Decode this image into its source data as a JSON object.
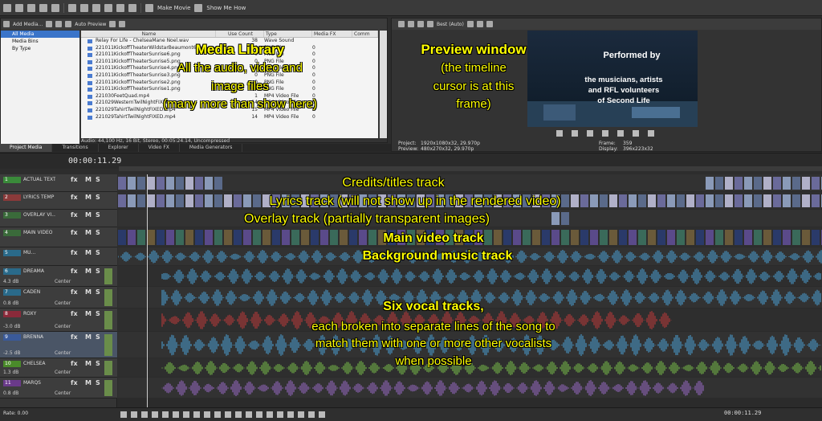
{
  "menubar": {
    "make_movie": "Make Movie",
    "show_me_how": "Show Me How"
  },
  "media": {
    "toolbar": {
      "add_media": "Add Media...",
      "auto_preview": "Auto Preview"
    },
    "tree": [
      "All Media",
      "Media Bins",
      "By Type"
    ],
    "columns": [
      "Name",
      "Use Count",
      "Type",
      "Media FX",
      "Comm"
    ],
    "rows": [
      {
        "name": "Relay For Life - ChelseaMane Noel.wav",
        "count": "38",
        "type": "Wave Sound",
        "fx": ""
      },
      {
        "name": "221011KickoffTheaterWildstarBeaumont6.png",
        "count": "0",
        "type": "PNG File",
        "fx": "0"
      },
      {
        "name": "221011KickoffTheaterSunrise6.png",
        "count": "0",
        "type": "PNG File",
        "fx": "0"
      },
      {
        "name": "221011KickoffTheaterSunrise5.png",
        "count": "0",
        "type": "PNG File",
        "fx": "0"
      },
      {
        "name": "221011KickoffTheaterSunrise4.png",
        "count": "0",
        "type": "PNG File",
        "fx": "0"
      },
      {
        "name": "221011KickoffTheaterSunrise3.png",
        "count": "0",
        "type": "PNG File",
        "fx": "0"
      },
      {
        "name": "221011KickoffTheaterSunrise2.png",
        "count": "0",
        "type": "PNG File",
        "fx": "0"
      },
      {
        "name": "221011KickoffTheaterSunrise1.png",
        "count": "0",
        "type": "PNG File",
        "fx": "0"
      },
      {
        "name": "221030FeetQuad.mp4",
        "count": "1",
        "type": "MP4 Video File",
        "fx": "0"
      },
      {
        "name": "221029WesternTwilNightFIXED.mp4",
        "count": "14",
        "type": "MP4 Video File",
        "fx": "0"
      },
      {
        "name": "221029TahirtTwilNightFIXED.mp4",
        "count": "15",
        "type": "MP4 Video File",
        "fx": "0"
      },
      {
        "name": "221029TahirtTwilNightFIXED.mp4",
        "count": "14",
        "type": "MP4 Video File",
        "fx": "0"
      }
    ],
    "status": "Audio: 44,100 Hz, 16 Bit, Stereo, 00:05:24.14, Uncompressed"
  },
  "tabs": [
    "Project Media",
    "Transitions",
    "Explorer",
    "Video FX",
    "Media Generators"
  ],
  "preview": {
    "quality": "Best (Auto)",
    "overlay_title": "Performed by",
    "overlay_line1": "the musicians, artists",
    "overlay_line2": "and RFL volunteers",
    "overlay_line3": "of Second Life",
    "project_label": "Project:",
    "project_value": "1920x1080x32, 29.970p",
    "preview_label": "Preview:",
    "preview_value": "480x270x32, 29.970p",
    "frame_label": "Frame:",
    "frame_value": "359",
    "display_label": "Display:",
    "display_value": "396x223x32"
  },
  "timeline": {
    "timecode": "00:00:11.29",
    "bottom_timecode": "00:00:11.29",
    "rate": "Rate: 0.00",
    "tracks": [
      {
        "num": "1",
        "name": "ACTUAL TEXT",
        "kind": "video",
        "color": "#3a8a3a"
      },
      {
        "num": "2",
        "name": "LYRICS TEMP",
        "kind": "video",
        "color": "#8a3a3a"
      },
      {
        "num": "3",
        "name": "OVERLAY VI...",
        "kind": "video",
        "color": "#3a6a3a"
      },
      {
        "num": "4",
        "name": "MAIN VIDEO",
        "kind": "video",
        "color": "#3a6a3a"
      },
      {
        "num": "5",
        "name": "MU...",
        "kind": "audio",
        "color": "#2a6a8a"
      },
      {
        "num": "6",
        "name": "DREAMA",
        "kind": "audio",
        "color": "#2a6a8a",
        "vol": "4.3 dB",
        "pan": "Center"
      },
      {
        "num": "7",
        "name": "CADEN",
        "kind": "audio",
        "color": "#2a6a8a",
        "vol": "0.8 dB",
        "pan": "Center"
      },
      {
        "num": "8",
        "name": "ROXY",
        "kind": "audio",
        "color": "#8a2a3a",
        "vol": "-3.0 dB",
        "pan": "Center"
      },
      {
        "num": "9",
        "name": "BRENNA",
        "kind": "audio",
        "color": "#3a5a9a",
        "vol": "-2.5 dB",
        "pan": "Center"
      },
      {
        "num": "10",
        "name": "CHELSEA",
        "kind": "audio",
        "color": "#4a8a2a",
        "vol": "1.3 dB",
        "pan": "Center"
      },
      {
        "num": "11",
        "name": "MARQS",
        "kind": "audio",
        "color": "#6a3a8a",
        "vol": "0.8 dB",
        "pan": "Center"
      }
    ]
  },
  "annotations": {
    "media_title": "Media Library",
    "media_l1": "All the audio, video and",
    "media_l2": "image files",
    "media_l3": "(many more than show here)",
    "preview_title": "Preview window",
    "preview_l1": "(the timeline",
    "preview_l2": "cursor is at this",
    "preview_l3": "frame)",
    "credits": "Credits/titles track",
    "lyrics": "Lyrics track (will not show up in the rendered video)",
    "overlay": "Overlay track (partially transparent images)",
    "main_video": "Main video track",
    "music": "Background music track",
    "six_vocal": "Six vocal tracks,",
    "vocal_l1": "each broken into separate lines of the song to",
    "vocal_l2": "match them with one or more other vocalists",
    "vocal_l3": "when possible"
  },
  "colors": {
    "annotation": "#ffff00",
    "audio_wave": "#4aa3d8",
    "roxy_wave": "#c23a3a",
    "chelsea_wave": "#7bc24a",
    "marqs_wave": "#9a6ac8"
  }
}
